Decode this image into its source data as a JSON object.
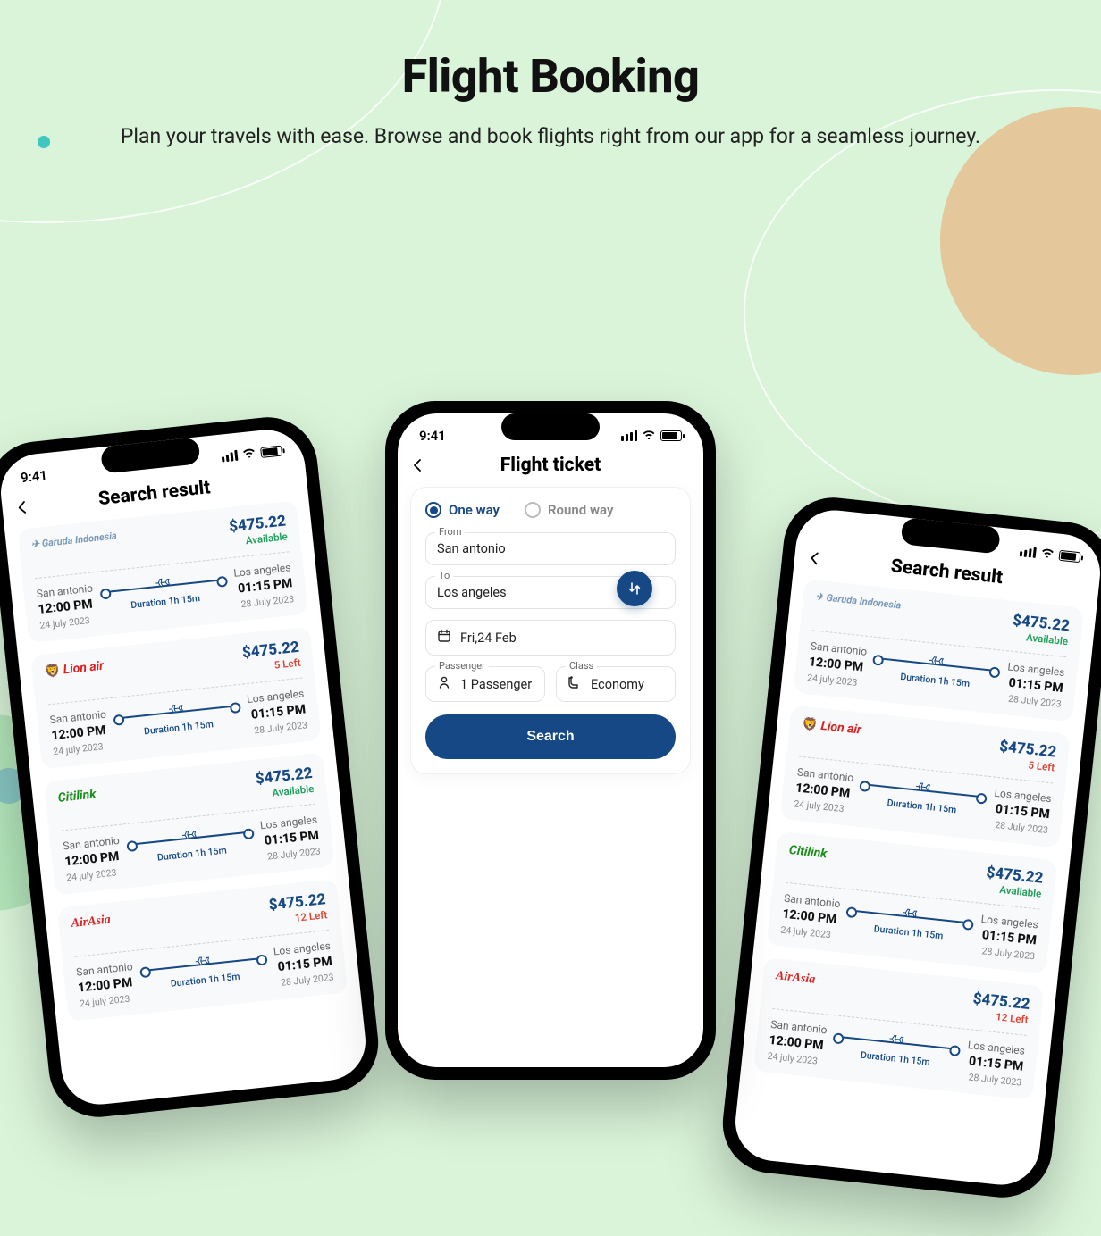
{
  "hero": {
    "title": "Flight Booking",
    "subtitle": "Plan your travels with ease. Browse and book flights right from our app for a seamless journey."
  },
  "common": {
    "clock": "9:41"
  },
  "center": {
    "title": "Flight ticket",
    "trip_types": {
      "one_way": "One way",
      "round_way": "Round way"
    },
    "from": {
      "label": "From",
      "value": "San antonio"
    },
    "to": {
      "label": "To",
      "value": "Los angeles"
    },
    "date": {
      "value": "Fri,24 Feb"
    },
    "passenger": {
      "label": "Passenger",
      "value": "1 Passenger"
    },
    "class": {
      "label": "Class",
      "value": "Economy"
    },
    "search_button": "Search"
  },
  "results_title": "Search result",
  "flights": [
    {
      "airline": "Garuda Indonesia",
      "airline_key": "garuda",
      "price": "$475.22",
      "status": "Available",
      "status_key": "avail",
      "from_city": "San antonio",
      "from_time": "12:00 PM",
      "from_date": "24 july 2023",
      "to_city": "Los angeles",
      "to_time": "01:15 PM",
      "to_date": "28 July 2023",
      "duration": "Duration 1h 15m"
    },
    {
      "airline": "Lion air",
      "airline_key": "lion",
      "price": "$475.22",
      "status": "5 Left",
      "status_key": "left",
      "from_city": "San antonio",
      "from_time": "12:00 PM",
      "from_date": "24 july 2023",
      "to_city": "Los angeles",
      "to_time": "01:15 PM",
      "to_date": "28 July 2023",
      "duration": "Duration 1h 15m"
    },
    {
      "airline": "Citilink",
      "airline_key": "citilink",
      "price": "$475.22",
      "status": "Available",
      "status_key": "avail",
      "from_city": "San antonio",
      "from_time": "12:00 PM",
      "from_date": "24 july 2023",
      "to_city": "Los angeles",
      "to_time": "01:15 PM",
      "to_date": "28 July 2023",
      "duration": "Duration 1h 15m"
    },
    {
      "airline": "AirAsia",
      "airline_key": "airasia",
      "price": "$475.22",
      "status": "12 Left",
      "status_key": "left",
      "from_city": "San antonio",
      "from_time": "12:00 PM",
      "from_date": "24 july 2023",
      "to_city": "Los angeles",
      "to_time": "01:15 PM",
      "to_date": "28 July 2023",
      "duration": "Duration 1h 15m"
    }
  ]
}
